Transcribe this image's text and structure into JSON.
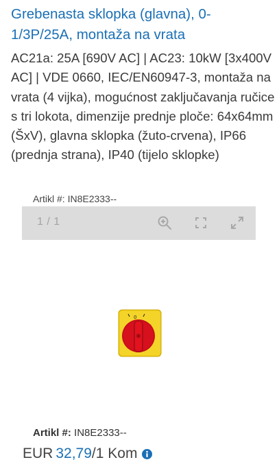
{
  "product": {
    "title": "Grebenasta sklopka (glavna), 0-1/3P/25A, montaža na vrata",
    "description": "AC21a: 25A [690V AC] | AC23: 10kW [3x400V AC] | VDE 0660, IEC/EN60947-3, montaža na vrata (4 vijka), mogućnost zaključavanja ručice s tri lokota, dimenzije prednje ploče: 64x64mm (ŠxV), glavna sklopka (žuto-crvena), IP66 (prednja strana), IP40 (tijelo sklopke)"
  },
  "artikl_top": "Artikl #: IN8E2333--",
  "gallery": {
    "counter": "1 / 1",
    "icons": [
      "zoom-in-icon",
      "fit-screen-icon",
      "fullscreen-icon"
    ],
    "bar_color": "#dcdcdc"
  },
  "artikl_bottom": {
    "label": "Artikl #:",
    "value": "IN8E2333--"
  },
  "price": {
    "currency": "EUR",
    "amount": "32,79",
    "unit": "/1 Kom",
    "info_icon": "info-icon"
  },
  "colors": {
    "accent": "#1a6fb5",
    "switch_yellow": "#f2cf1c",
    "switch_red": "#d7101e"
  }
}
